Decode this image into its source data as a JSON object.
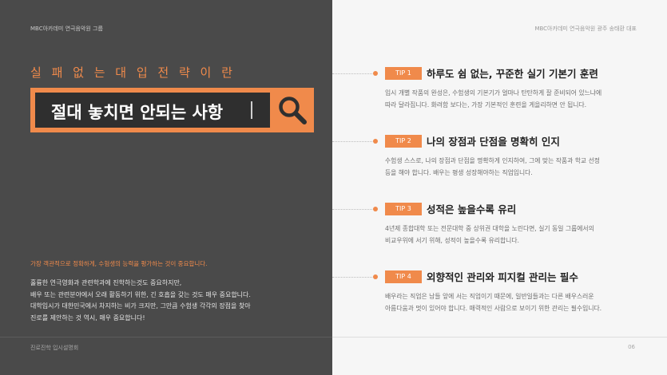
{
  "header": {
    "brand_left": "MBC아카데미 연극음악원 그룹",
    "brand_right": "MBC아카데미 연극음악원 광주 송태환 대표"
  },
  "left": {
    "heading_small": "실 패 없 는   대 입 전 략 이 란",
    "search_text": "절대 놓치면 안되는 사항",
    "lead": "가장 객관적으로 정확하게, 수험생의 능력을 평가하는 것이 중요합니다.",
    "body_lines": [
      "훌륭한 연극영화과 관련학과에 진학하는것도 중요하지만,",
      "배우 또는 관련분야에서 오래 활동하기 위한, 긴 호흡을 갖는 것도 매우 중요합니다.",
      "대학입시가 대한민국에서 차지하는 비가 크지만, 그만큼 수험생 각각의 장점을 찾아",
      "진로를 제안하는 것 역시, 매우 중요합니다!"
    ]
  },
  "tips": [
    {
      "badge": "TIP 1",
      "title": "하루도 쉼 없는, 꾸준한 실기 기본기 훈련",
      "desc": [
        "입시 개별 작품의 완성은, 수험생의 기본기가 얼마나 탄탄하게 잘 준비되어 있느냐에",
        "따라 달라집니다. 화려함 보다는, 가장 기본적인 훈련을 게을리하면 안 됩니다."
      ]
    },
    {
      "badge": "TIP 2",
      "title": "나의 장점과 단점을 명확히 인지",
      "desc": [
        "수험생 스스로, 나의 장점과 단점을 명확하게 인지하여, 그에 맞는 작품과 학교 선정",
        "등을 해야 합니다. 배우는 평생 성장해야하는 직업입니다."
      ]
    },
    {
      "badge": "TIP 3",
      "title": "성적은 높을수록 유리",
      "desc": [
        "4년제 종합대학 또는 전문대학 중 상위권 대학을 노린다면, 실기 동일 그룹에서의",
        "비교우위에 서기 위해, 성적이 높을수록 유리합니다."
      ]
    },
    {
      "badge": "TIP 4",
      "title": "외향적인 관리와 피지컬 관리는 필수",
      "desc": [
        "배우라는 직업은 남들 앞에 서는 직업이기 때문에, 일반일들과는 다른 배우스러운",
        "아름다움과 멋이 있어야 합니다. 매력적인 사람으로 보이기 위한 관리는 필수입니다."
      ]
    }
  ],
  "footer": {
    "left": "진로진학 입시설명회",
    "page": "06"
  },
  "colors": {
    "accent": "#f08a4b",
    "dark_panel": "#4a4a4a",
    "light_panel": "#f6f6f6"
  },
  "icons": {
    "search": "search-icon"
  }
}
